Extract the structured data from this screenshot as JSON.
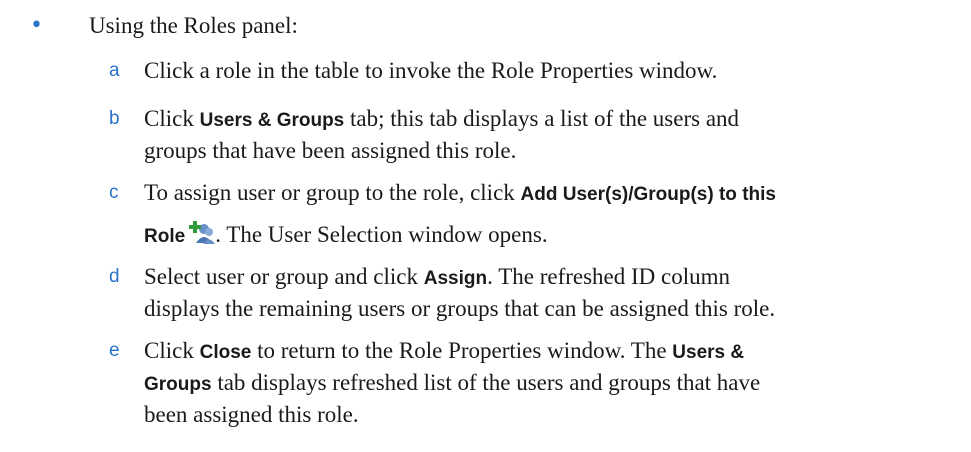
{
  "intro": "Using the Roles panel:",
  "steps": [
    {
      "letter": "a",
      "lines": [
        "Click a role in the table to invoke the Role Properties window."
      ]
    },
    {
      "letter": "b",
      "l1_pre": "Click ",
      "l1_bold": "Users & Groups",
      "l1_post": " tab; this tab displays a list of the users and",
      "l2": "groups that have been assigned this role."
    },
    {
      "letter": "c",
      "l1_pre": "To assign user or group to the role, click ",
      "l1_bold": "Add User(s)/Group(s) to this",
      "l2_bold": "Role",
      "l2_post": ". The User Selection window opens.",
      "icon": "add-users-to-role-icon"
    },
    {
      "letter": "d",
      "l1_pre": "Select user or group and click ",
      "l1_bold": "Assign",
      "l1_post": ". The refreshed ID column",
      "l2": "displays the remaining users or groups that can be assigned this role."
    },
    {
      "letter": "e",
      "l1_pre": "Click ",
      "l1_bold": "Close",
      "l1_mid": " to return to the Role Properties window. The ",
      "l1_bold2": "Users &",
      "l2_bold": "Groups",
      "l2_post": " tab displays refreshed list of the users and groups that have",
      "l3": "been assigned this role."
    }
  ],
  "colors": {
    "accent": "#2a73c9",
    "text": "#1a1a1a"
  }
}
